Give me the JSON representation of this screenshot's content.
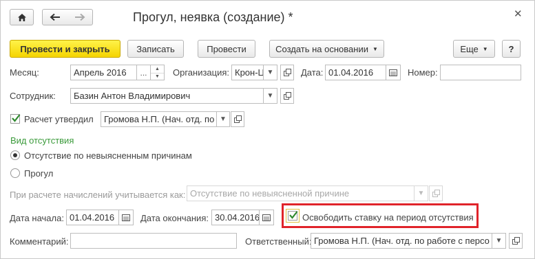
{
  "window": {
    "title": "Прогул, неявка (создание) *",
    "close_icon": "close-icon"
  },
  "toolbar": {
    "home_icon": "home-icon",
    "back_icon": "arrow-left-icon",
    "forward_icon": "arrow-right-icon",
    "post_close_label": "Провести и закрыть",
    "save_label": "Записать",
    "post_label": "Провести",
    "create_based_label": "Создать на основании",
    "more_label": "Еще",
    "help_label": "?"
  },
  "form": {
    "month_label": "Месяц:",
    "month_value": "Апрель 2016",
    "month_picker": "...",
    "org_label": "Организация:",
    "org_value": "Крон-Ц",
    "date_label": "Дата:",
    "date_value": "01.04.2016",
    "number_label": "Номер:",
    "number_value": "",
    "employee_label": "Сотрудник:",
    "employee_value": "Базин Антон Владимирович",
    "approved_label": "Расчет утвердил",
    "approved_checked": true,
    "approved_value": "Громова Н.П. (Нач. отд. по",
    "absence_type_title": "Вид отсутствия",
    "option_unexplained": "Отсутствие по невыясненным причинам",
    "option_truancy": "Прогул",
    "selected_option": "unexplained",
    "accrual_label": "При расчете начислений учитывается как:",
    "accrual_value": "Отсутствие по невыясненной причине",
    "start_label": "Дата начала:",
    "start_value": "01.04.2016",
    "end_label": "Дата окончания:",
    "end_value": "30.04.2016",
    "free_rate_label": "Освободить ставку на период отсутствия",
    "free_rate_checked": true,
    "comment_label": "Комментарий:",
    "comment_value": "",
    "responsible_label": "Ответственный:",
    "responsible_value": "Громова Н.П. (Нач. отд. по работе с персо"
  },
  "colors": {
    "primary_button": "#f5d400",
    "group_title": "#3a9a3a",
    "highlight_border": "#e0232a",
    "check_mark": "#2f8a2f"
  }
}
